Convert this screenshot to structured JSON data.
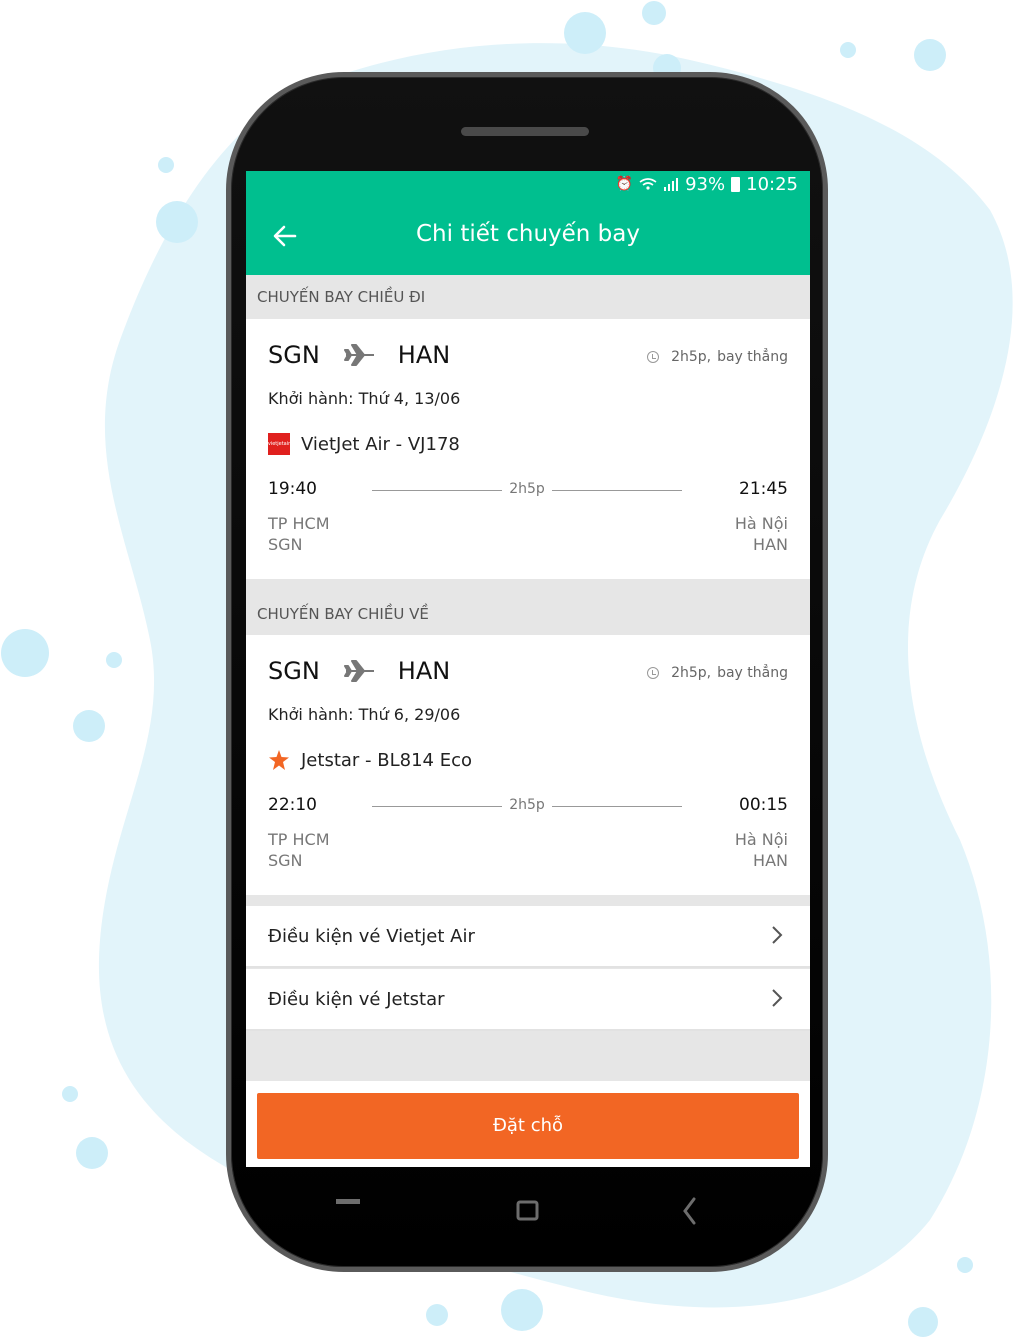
{
  "status_bar": {
    "battery_percent": "93%",
    "time": "10:25",
    "icons": [
      "alarm-icon",
      "wifi-icon",
      "signal-icon",
      "battery-icon"
    ]
  },
  "header": {
    "title": "Chi tiết chuyến bay",
    "back_icon": "arrow-left-icon"
  },
  "outbound": {
    "section_label": "CHUYẾN BAY CHIỀU ĐI",
    "from": "SGN",
    "to": "HAN",
    "duration": "2h5p,",
    "flight_type": "bay thẳng",
    "depart_date": "Khởi hành: Thứ 4, 13/06",
    "airline": "VietJet Air - VJ178",
    "airline_logo_text": "vietjetair",
    "dep_time": "19:40",
    "arr_time": "21:45",
    "line_duration": "2h5p",
    "dep_city": "TP HCM",
    "dep_code": "SGN",
    "arr_city": "Hà Nội",
    "arr_code": "HAN"
  },
  "return": {
    "section_label": "CHUYẾN BAY CHIỀU VỀ",
    "from": "SGN",
    "to": "HAN",
    "duration": "2h5p,",
    "flight_type": "bay thẳng",
    "depart_date": "Khởi hành: Thứ 6, 29/06",
    "airline": "Jetstar - BL814 Eco",
    "dep_time": "22:10",
    "arr_time": "00:15",
    "line_duration": "2h5p",
    "dep_city": "TP HCM",
    "dep_code": "SGN",
    "arr_city": "Hà Nội",
    "arr_code": "HAN"
  },
  "conditions": [
    {
      "label": "Điều kiện vé Vietjet Air"
    },
    {
      "label": "Điều kiện vé Jetstar"
    }
  ],
  "book_button": "Đặt chỗ",
  "colors": {
    "primary": "#00bf8f",
    "accent": "#f26624",
    "vietjet": "#e0201e",
    "jetstar": "#f26624",
    "blob": "#e2f4fa",
    "dot": "#cdeef9"
  }
}
